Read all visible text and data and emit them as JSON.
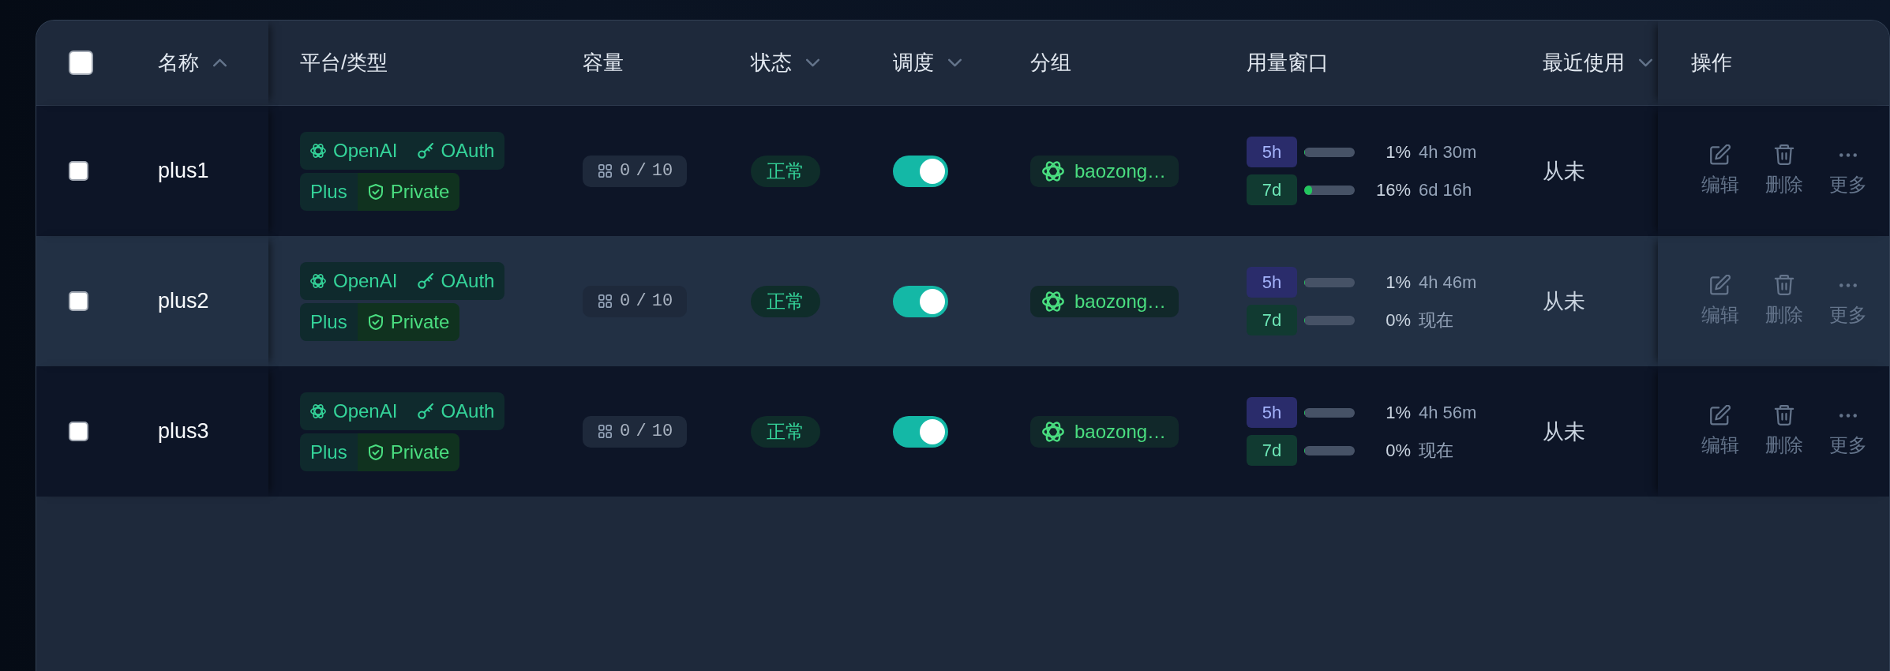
{
  "table": {
    "select_all": {
      "checked": false
    },
    "columns": [
      {
        "label": "名称",
        "kind": "sorted"
      },
      {
        "label": "平台/类型",
        "kind": "plain"
      },
      {
        "label": "容量",
        "kind": "plain"
      },
      {
        "label": "状态",
        "kind": "filter"
      },
      {
        "label": "调度",
        "kind": "filter"
      },
      {
        "label": "分组",
        "kind": "plain"
      },
      {
        "label": "用量窗口",
        "kind": "plain"
      },
      {
        "label": "最近使用",
        "kind": "filter"
      },
      {
        "label": "操作",
        "kind": "plain"
      }
    ],
    "rows": [
      {
        "checked": false,
        "highlighted": false,
        "name": "plus1",
        "platform": "OpenAI",
        "auth": "OAuth",
        "plan": "Plus",
        "privacy": "Private",
        "capacity": "0 / 10",
        "status": {
          "kind": "ok",
          "label": "正常"
        },
        "schedulable": true,
        "group": "baozong…",
        "usage": [
          {
            "kind": "hours",
            "window": "5h",
            "level": 0.01,
            "percent": "1%",
            "reset": "4h 30m"
          },
          {
            "kind": "days",
            "window": "7d",
            "level": 0.16,
            "percent": "16%",
            "reset": "6d 16h"
          }
        ],
        "last_used": "从未",
        "actions": [
          {
            "kind": "edit",
            "label": "编辑"
          },
          {
            "kind": "delete",
            "label": "删除"
          },
          {
            "kind": "more",
            "label": "更多"
          }
        ]
      },
      {
        "checked": false,
        "highlighted": true,
        "name": "plus2",
        "platform": "OpenAI",
        "auth": "OAuth",
        "plan": "Plus",
        "privacy": "Private",
        "capacity": "0 / 10",
        "status": {
          "kind": "ok",
          "label": "正常"
        },
        "schedulable": true,
        "group": "baozong…",
        "usage": [
          {
            "kind": "hours",
            "window": "5h",
            "level": 0.01,
            "percent": "1%",
            "reset": "4h 46m"
          },
          {
            "kind": "days",
            "window": "7d",
            "level": 0,
            "percent": "0%",
            "reset": "现在"
          }
        ],
        "last_used": "从未",
        "actions": [
          {
            "kind": "edit",
            "label": "编辑"
          },
          {
            "kind": "delete",
            "label": "删除"
          },
          {
            "kind": "more",
            "label": "更多"
          }
        ]
      },
      {
        "checked": false,
        "highlighted": false,
        "name": "plus3",
        "platform": "OpenAI",
        "auth": "OAuth",
        "plan": "Plus",
        "privacy": "Private",
        "capacity": "0 / 10",
        "status": {
          "kind": "ok",
          "label": "正常"
        },
        "schedulable": true,
        "group": "baozong…",
        "usage": [
          {
            "kind": "hours",
            "window": "5h",
            "level": 0.01,
            "percent": "1%",
            "reset": "4h 56m"
          },
          {
            "kind": "days",
            "window": "7d",
            "level": 0,
            "percent": "0%",
            "reset": "现在"
          }
        ],
        "last_used": "从未",
        "actions": [
          {
            "kind": "edit",
            "label": "编辑"
          },
          {
            "kind": "delete",
            "label": "删除"
          },
          {
            "kind": "more",
            "label": "更多"
          }
        ]
      }
    ]
  }
}
